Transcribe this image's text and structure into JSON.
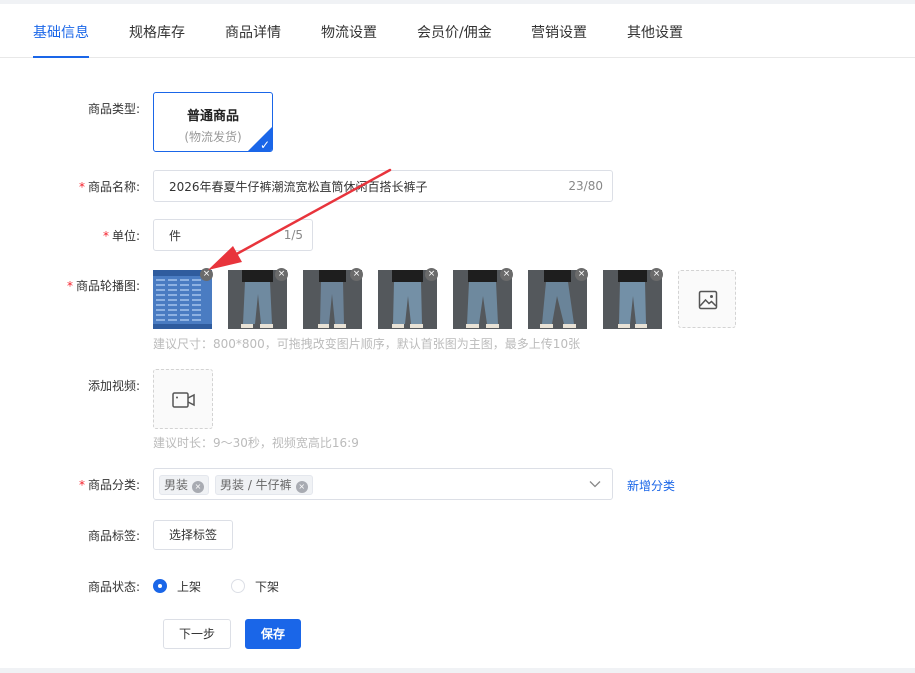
{
  "tabs": [
    "基础信息",
    "规格库存",
    "商品详情",
    "物流设置",
    "会员价/佣金",
    "营销设置",
    "其他设置"
  ],
  "form": {
    "type_label": "商品类型:",
    "type_card": {
      "title": "普通商品",
      "subtitle": "(物流发货)"
    },
    "name_label": "商品名称:",
    "name_value": "2026年春夏牛仔裤潮流宽松直筒休闲百搭长裤子",
    "name_counter": "23/80",
    "unit_label": "单位:",
    "unit_value": "件",
    "unit_counter": "1/5",
    "carousel_label": "商品轮播图:",
    "carousel_hint": "建议尺寸：800*800，可拖拽改变图片顺序，默认首张图为主图，最多上传10张",
    "video_label": "添加视频:",
    "video_hint": "建议时长：9～30秒，视频宽高比16:9",
    "category_label": "商品分类:",
    "category_tags": [
      "男装",
      "男装 / 牛仔裤"
    ],
    "category_add": "新增分类",
    "tag_label": "商品标签:",
    "tag_button": "选择标签",
    "status_label": "商品状态:",
    "status_options": [
      "上架",
      "下架"
    ],
    "status_selected": "上架"
  },
  "buttons": {
    "next": "下一步",
    "save": "保存"
  },
  "icons": {
    "close": "close-icon",
    "add_image": "image-icon",
    "add_video": "video-camera-icon",
    "dropdown": "chevron-down-icon",
    "check": "check-icon"
  },
  "colors": {
    "primary": "#1a66e8",
    "required": "#f5222d",
    "annotation_arrow": "#e8343c"
  }
}
